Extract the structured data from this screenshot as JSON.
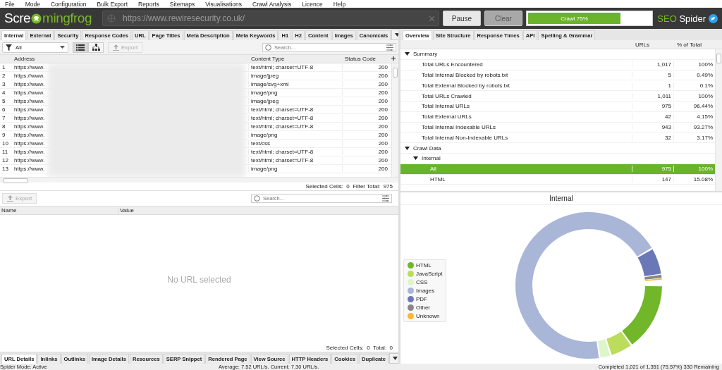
{
  "menu": [
    "File",
    "Mode",
    "Configuration",
    "Bulk Export",
    "Reports",
    "Sitemaps",
    "Visualisations",
    "Crawl Analysis",
    "Licence",
    "Help"
  ],
  "header": {
    "logo_start": "Scre",
    "logo_end": "mingfrog",
    "url": "https://www.rewiresecurity.co.uk/",
    "buttons": [
      {
        "label": "Pause",
        "disabled": false
      },
      {
        "label": "Clear",
        "disabled": true
      }
    ],
    "progress": {
      "label": "Crawl 75%",
      "level": 0.75
    },
    "brand_accent": "SEO",
    "brand": "Spider"
  },
  "left_tabs": [
    {
      "label": "Internal",
      "selected": true
    },
    {
      "label": "External",
      "selected": false
    },
    {
      "label": "Security",
      "selected": false
    },
    {
      "label": "Response Codes",
      "selected": false
    },
    {
      "label": "URL",
      "selected": false
    },
    {
      "label": "Page Titles",
      "selected": false
    },
    {
      "label": "Meta Description",
      "selected": false
    },
    {
      "label": "Meta Keywords",
      "selected": false
    },
    {
      "label": "H1",
      "selected": false
    },
    {
      "label": "H2",
      "selected": false
    },
    {
      "label": "Content",
      "selected": false
    },
    {
      "label": "Images",
      "selected": false
    },
    {
      "label": "Canonicals",
      "selected": false
    }
  ],
  "toolbar": {
    "filter": "All",
    "views": [
      {
        "kind": "list",
        "selected": true
      },
      {
        "kind": "tree",
        "selected": false
      }
    ],
    "export": {
      "label": "Export",
      "disabled": true
    },
    "search": {
      "placeholder": "Search..."
    }
  },
  "table": {
    "columns": [
      "Address",
      "Content Type",
      "Status Code"
    ],
    "rows": [
      {
        "n": "1",
        "address": "https://www.",
        "type": "text/html; charset=UTF-8",
        "status": "200"
      },
      {
        "n": "2",
        "address": "https://www.",
        "type": "image/jpeg",
        "status": "200"
      },
      {
        "n": "3",
        "address": "https://www.",
        "type": "image/svg+xml",
        "status": "200"
      },
      {
        "n": "4",
        "address": "https://www.",
        "type": "image/png",
        "status": "200"
      },
      {
        "n": "5",
        "address": "https://www.",
        "type": "image/jpeg",
        "status": "200"
      },
      {
        "n": "6",
        "address": "https://www.",
        "type": "text/html; charset=UTF-8",
        "status": "200"
      },
      {
        "n": "7",
        "address": "https://www.",
        "type": "text/html; charset=UTF-8",
        "status": "200"
      },
      {
        "n": "8",
        "address": "https://www.",
        "type": "text/html; charset=UTF-8",
        "status": "200"
      },
      {
        "n": "9",
        "address": "https://www.",
        "type": "image/png",
        "status": "200"
      },
      {
        "n": "10",
        "address": "https://www.",
        "type": "text/css",
        "status": "200"
      },
      {
        "n": "11",
        "address": "https://www.",
        "type": "text/html; charset=UTF-8",
        "status": "200"
      },
      {
        "n": "12",
        "address": "https://www.",
        "type": "text/html; charset=UTF-8",
        "status": "200"
      },
      {
        "n": "13",
        "address": "https://www.",
        "type": "image/png",
        "status": "200"
      }
    ],
    "status": "Selected Cells:  0  Filter Total:  975"
  },
  "details": {
    "export": {
      "label": "Export",
      "disabled": true
    },
    "search": {
      "placeholder": "Search..."
    },
    "columns": [
      "Name",
      "Value"
    ],
    "empty": "No URL selected",
    "status": "Selected Cells:  0  Total:  0"
  },
  "bottom_tabs": [
    {
      "label": "URL Details",
      "selected": true
    },
    {
      "label": "Inlinks",
      "selected": false
    },
    {
      "label": "Outlinks",
      "selected": false
    },
    {
      "label": "Image Details",
      "selected": false
    },
    {
      "label": "Resources",
      "selected": false
    },
    {
      "label": "SERP Snippet",
      "selected": false
    },
    {
      "label": "Rendered Page",
      "selected": false
    },
    {
      "label": "View Source",
      "selected": false
    },
    {
      "label": "HTTP Headers",
      "selected": false
    },
    {
      "label": "Cookies",
      "selected": false
    },
    {
      "label": "Duplicate",
      "selected": false
    }
  ],
  "right_tabs": [
    {
      "label": "Overview",
      "selected": true
    },
    {
      "label": "Site Structure",
      "selected": false
    },
    {
      "label": "Response Times",
      "selected": false
    },
    {
      "label": "API",
      "selected": false
    },
    {
      "label": "Spelling & Grammar",
      "selected": false
    }
  ],
  "overview": {
    "columns": [
      "URLs",
      "% of Total"
    ],
    "tree": [
      {
        "label": "Summary",
        "expanded": true,
        "selected": false,
        "children": [
          {
            "label": "Total URLs Encountered",
            "urls": "1,017",
            "pct": "100%",
            "selected": false
          },
          {
            "label": "Total Internal Blocked by robots.txt",
            "urls": "5",
            "pct": "0.49%",
            "selected": false
          },
          {
            "label": "Total External Blocked by robots.txt",
            "urls": "1",
            "pct": "0.1%",
            "selected": false
          },
          {
            "label": "Total URLs Crawled",
            "urls": "1,011",
            "pct": "100%",
            "selected": false
          },
          {
            "label": "Total Internal URLs",
            "urls": "975",
            "pct": "96.44%",
            "selected": false
          },
          {
            "label": "Total External URLs",
            "urls": "42",
            "pct": "4.15%",
            "selected": false
          },
          {
            "label": "Total Internal Indexable URLs",
            "urls": "943",
            "pct": "93.27%",
            "selected": false
          },
          {
            "label": "Total Internal Non-Indexable URLs",
            "urls": "32",
            "pct": "3.17%",
            "selected": false
          }
        ]
      },
      {
        "label": "Crawl Data",
        "expanded": true,
        "selected": false,
        "children": [
          {
            "label": "Internal",
            "expanded": true,
            "selected": false,
            "children": [
              {
                "label": "All",
                "urls": "975",
                "pct": "100%",
                "selected": true
              },
              {
                "label": "HTML",
                "urls": "147",
                "pct": "15.08%",
                "selected": false
              }
            ]
          }
        ]
      }
    ]
  },
  "chart": {
    "title": "Internal",
    "legend": [
      {
        "label": "HTML",
        "color": "#72b62a"
      },
      {
        "label": "JavaScript",
        "color": "#bcdc5c"
      },
      {
        "label": "CSS",
        "color": "#ddf5c8"
      },
      {
        "label": "Images",
        "color": "#a9b6d8"
      },
      {
        "label": "PDF",
        "color": "#6b78b8"
      },
      {
        "label": "Other",
        "color": "#888888"
      },
      {
        "label": "Unknown",
        "color": "#fbb830"
      }
    ]
  },
  "status_bar": {
    "mode": "Spider Mode: Active",
    "speed": "Average: 7.52 URL/s. Current: 7.30 URL/s.",
    "progress": "Completed 1,021 of 1,351 (75.57%) 330 Remaining"
  }
}
